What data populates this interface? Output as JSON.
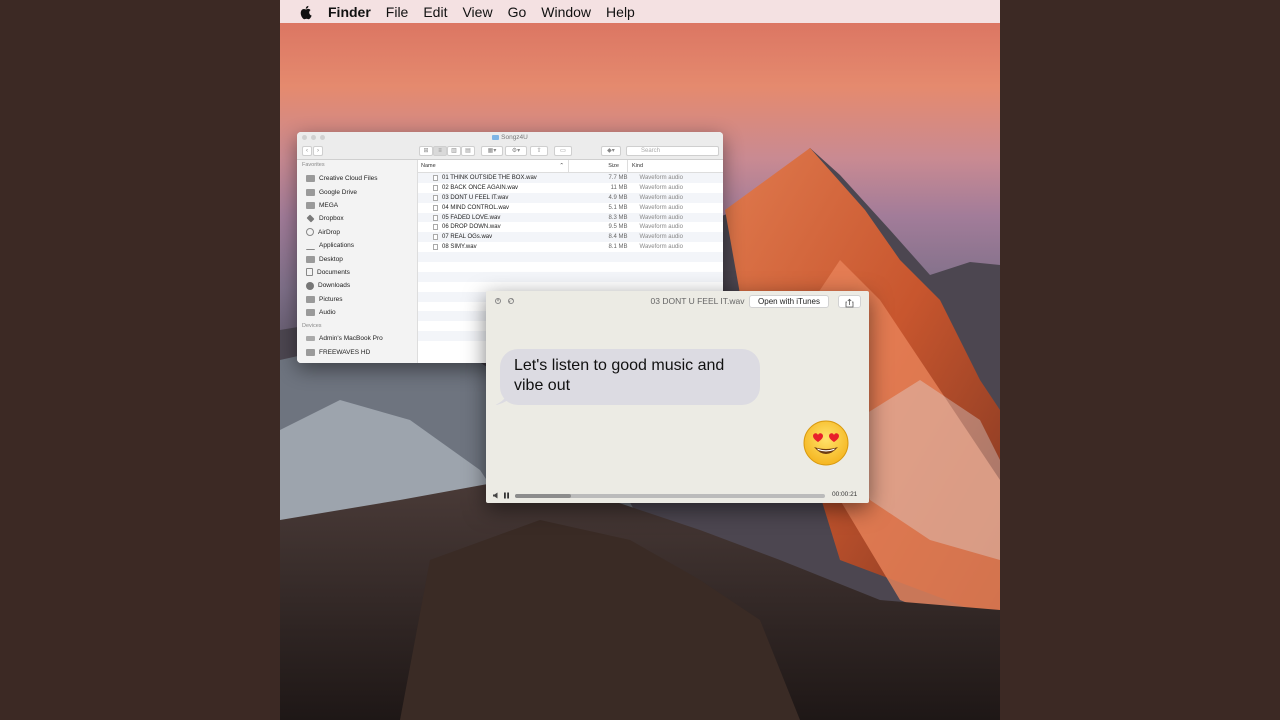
{
  "menubar": {
    "app": "Finder",
    "items": [
      "File",
      "Edit",
      "View",
      "Go",
      "Window",
      "Help"
    ]
  },
  "finder": {
    "title": "Songz4U",
    "search_placeholder": "Search",
    "sidebar": {
      "favorites_header": "Favorites",
      "favorites": [
        "Creative Cloud Files",
        "Google Drive",
        "MEGA",
        "Dropbox",
        "AirDrop",
        "Applications",
        "Desktop",
        "Documents",
        "Downloads",
        "Pictures",
        "Audio"
      ],
      "devices_header": "Devices",
      "devices": [
        "Admin's MacBook Pro",
        "FREEWAVES HD"
      ]
    },
    "columns": {
      "name": "Name",
      "size": "Size",
      "kind": "Kind"
    },
    "files": [
      {
        "name": "01 THINK OUTSIDE THE BOX.wav",
        "size": "7.7 MB",
        "kind": "Waveform audio"
      },
      {
        "name": "02 BACK ONCE AGAIN.wav",
        "size": "11 MB",
        "kind": "Waveform audio"
      },
      {
        "name": "03 DONT U FEEL IT.wav",
        "size": "4.9 MB",
        "kind": "Waveform audio"
      },
      {
        "name": "04 MIND CONTROL.wav",
        "size": "5.1 MB",
        "kind": "Waveform audio"
      },
      {
        "name": "05 FADED LOVE.wav",
        "size": "8.3 MB",
        "kind": "Waveform audio"
      },
      {
        "name": "06 DROP DOWN.wav",
        "size": "9.5 MB",
        "kind": "Waveform audio"
      },
      {
        "name": "07 REAL OGs.wav",
        "size": "8.4 MB",
        "kind": "Waveform audio"
      },
      {
        "name": "08 SIMY.wav",
        "size": "8.1 MB",
        "kind": "Waveform audio"
      }
    ]
  },
  "player": {
    "filename": "03 DONT U FEEL IT.wav",
    "open_button": "Open with iTunes",
    "message": "Let's listen to good music and vibe out",
    "time": "00:00:21",
    "progress": 0.18,
    "emoji": "heart-eyes-emoji"
  },
  "colors": {
    "bubble": "#dcdbe2",
    "player_bg": "#ecebe4",
    "page_bg": "#3c2924"
  }
}
